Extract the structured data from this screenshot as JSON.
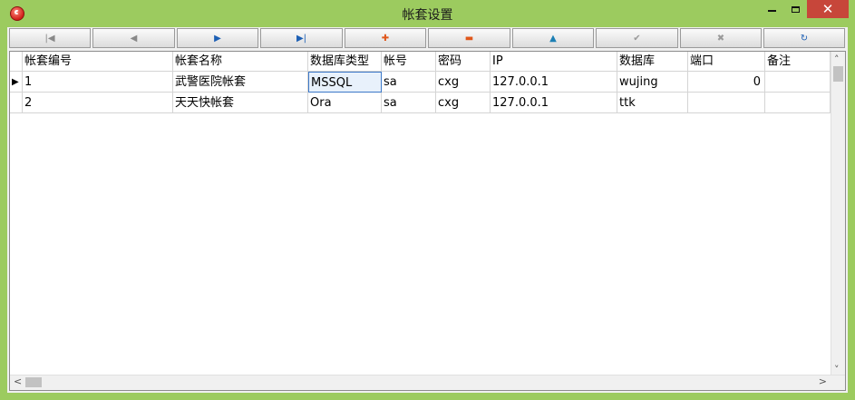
{
  "window": {
    "title": "帐套设置",
    "close_glyph": "✕"
  },
  "navigator": {
    "buttons": [
      {
        "name": "first-record",
        "glyph": "|◀",
        "color": "#888888"
      },
      {
        "name": "prior-record",
        "glyph": "◀",
        "color": "#888888"
      },
      {
        "name": "next-record",
        "glyph": "▶",
        "color": "#1c5fb4"
      },
      {
        "name": "last-record",
        "glyph": "▶|",
        "color": "#1c5fb4"
      },
      {
        "name": "insert-record",
        "glyph": "✚",
        "color": "#e0561a"
      },
      {
        "name": "delete-record",
        "glyph": "▬",
        "color": "#e0561a"
      },
      {
        "name": "edit-record",
        "glyph": "▲",
        "color": "#1c7fb4"
      },
      {
        "name": "post-edit",
        "glyph": "✔",
        "color": "#9a9a9a"
      },
      {
        "name": "cancel-edit",
        "glyph": "✖",
        "color": "#9a9a9a"
      },
      {
        "name": "refresh-data",
        "glyph": "↻",
        "color": "#1c5fb4"
      }
    ]
  },
  "grid": {
    "columns": [
      "帐套编号",
      "帐套名称",
      "数据库类型",
      "帐号",
      "密码",
      "IP",
      "数据库",
      "端口",
      "备注"
    ],
    "rows": [
      [
        "1",
        "武警医院帐套",
        "MSSQL",
        "sa",
        "cxg",
        "127.0.0.1",
        "wujing",
        "0",
        ""
      ],
      [
        "2",
        "天天快帐套",
        "Ora",
        "sa",
        "cxg",
        "127.0.0.1",
        "ttk",
        "",
        ""
      ]
    ],
    "current_row_indicator": "▶"
  },
  "scrollbars": {
    "up": "˄",
    "down": "˅",
    "left": "<",
    "right": ">"
  }
}
